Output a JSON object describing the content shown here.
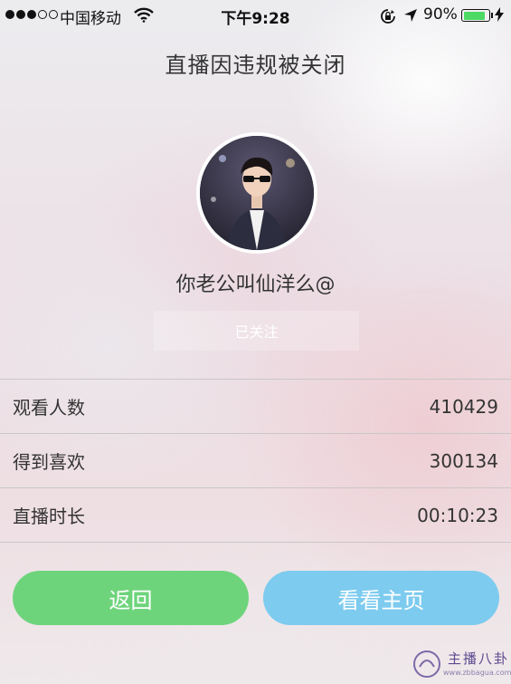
{
  "status_bar": {
    "carrier": "中国移动",
    "time": "下午9:28",
    "battery_percent": "90%",
    "battery_level": 0.9,
    "signal_strength": 3
  },
  "page_title": "直播因违规被关闭",
  "profile": {
    "username": "你老公叫仙洋么@",
    "follow_label": "已关注"
  },
  "stats": [
    {
      "label": "观看人数",
      "value": "410429"
    },
    {
      "label": "得到喜欢",
      "value": "300134"
    },
    {
      "label": "直播时长",
      "value": "00:10:23"
    }
  ],
  "buttons": {
    "back": "返回",
    "view_homepage": "看看主页"
  },
  "watermark": {
    "text": "主播八卦",
    "url": "www.zbbagua.com.cn"
  },
  "colors": {
    "back_button": "#6ed47c",
    "home_button": "#7dcbef",
    "battery": "#4cd964"
  }
}
